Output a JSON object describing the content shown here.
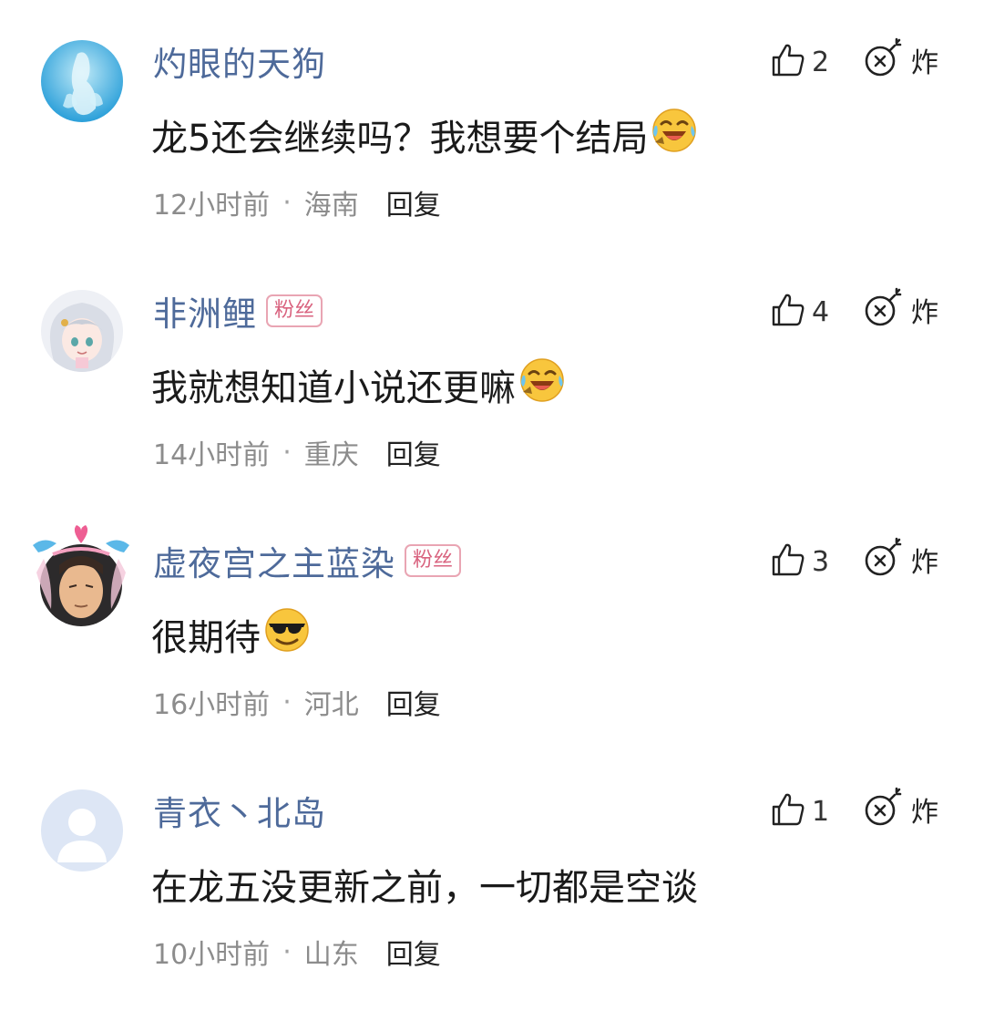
{
  "comments": [
    {
      "username": "灼眼的天狗",
      "badge": "",
      "likes": "2",
      "bomb_label": "炸",
      "text": "龙5还会继续吗？我想要个结局",
      "emoji": "laughing-crying-emoji",
      "time": "12小时前",
      "location": "海南",
      "reply_label": "回复"
    },
    {
      "username": "非洲鲤",
      "badge": "粉丝",
      "likes": "4",
      "bomb_label": "炸",
      "text": "我就想知道小说还更嘛",
      "emoji": "laughing-crying-emoji",
      "time": "14小时前",
      "location": "重庆",
      "reply_label": "回复"
    },
    {
      "username": "虚夜宫之主蓝染",
      "badge": "粉丝",
      "likes": "3",
      "bomb_label": "炸",
      "text": "很期待",
      "emoji": "sunglasses-emoji",
      "time": "16小时前",
      "location": "河北",
      "reply_label": "回复"
    },
    {
      "username": "青衣丶北岛",
      "badge": "",
      "likes": "1",
      "bomb_label": "炸",
      "text": "在龙五没更新之前，一切都是空谈",
      "emoji": "",
      "time": "10小时前",
      "location": "山东",
      "reply_label": "回复"
    }
  ],
  "colors": {
    "username": "#4e6a9a",
    "badge_border": "#e9a5b3",
    "badge_text": "#d9637f",
    "meta": "#8c8c8c",
    "text": "#1a1a1a"
  },
  "separator_dot": "·"
}
